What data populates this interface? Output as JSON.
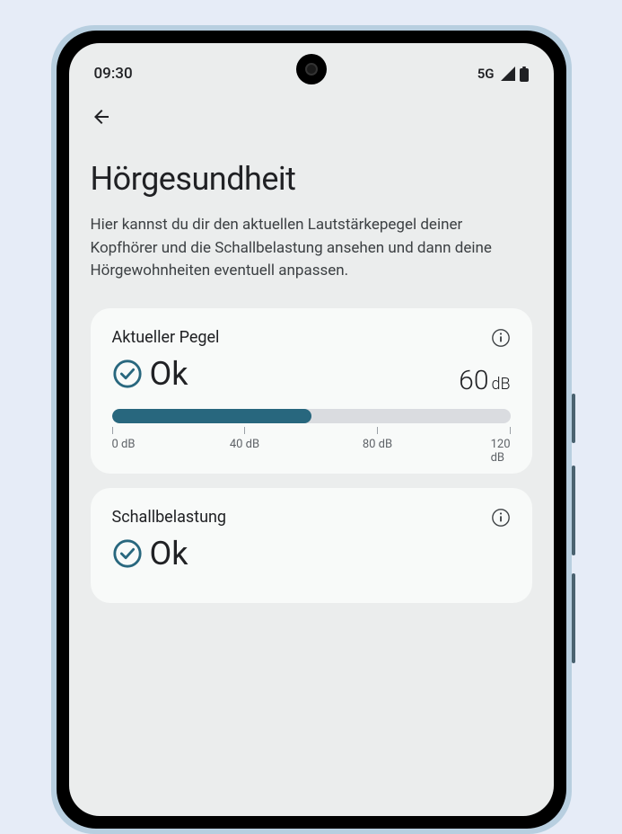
{
  "statusBar": {
    "time": "09:30",
    "network": "5G"
  },
  "page": {
    "title": "Hörgesundheit",
    "description": "Hier kannst du dir den aktuellen Lautstärkepegel deiner Kopfhörer und die Schallbelastung ansehen und dann deine Hörgewohnheiten eventuell anpassen."
  },
  "currentLevel": {
    "title": "Aktueller Pegel",
    "status": "Ok",
    "value": "60",
    "unit": "dB",
    "scale": [
      "0 dB",
      "40 dB",
      "80 dB",
      "120 dB"
    ],
    "accentColor": "#28677e"
  },
  "exposure": {
    "title": "Schallbelastung",
    "status": "Ok"
  }
}
